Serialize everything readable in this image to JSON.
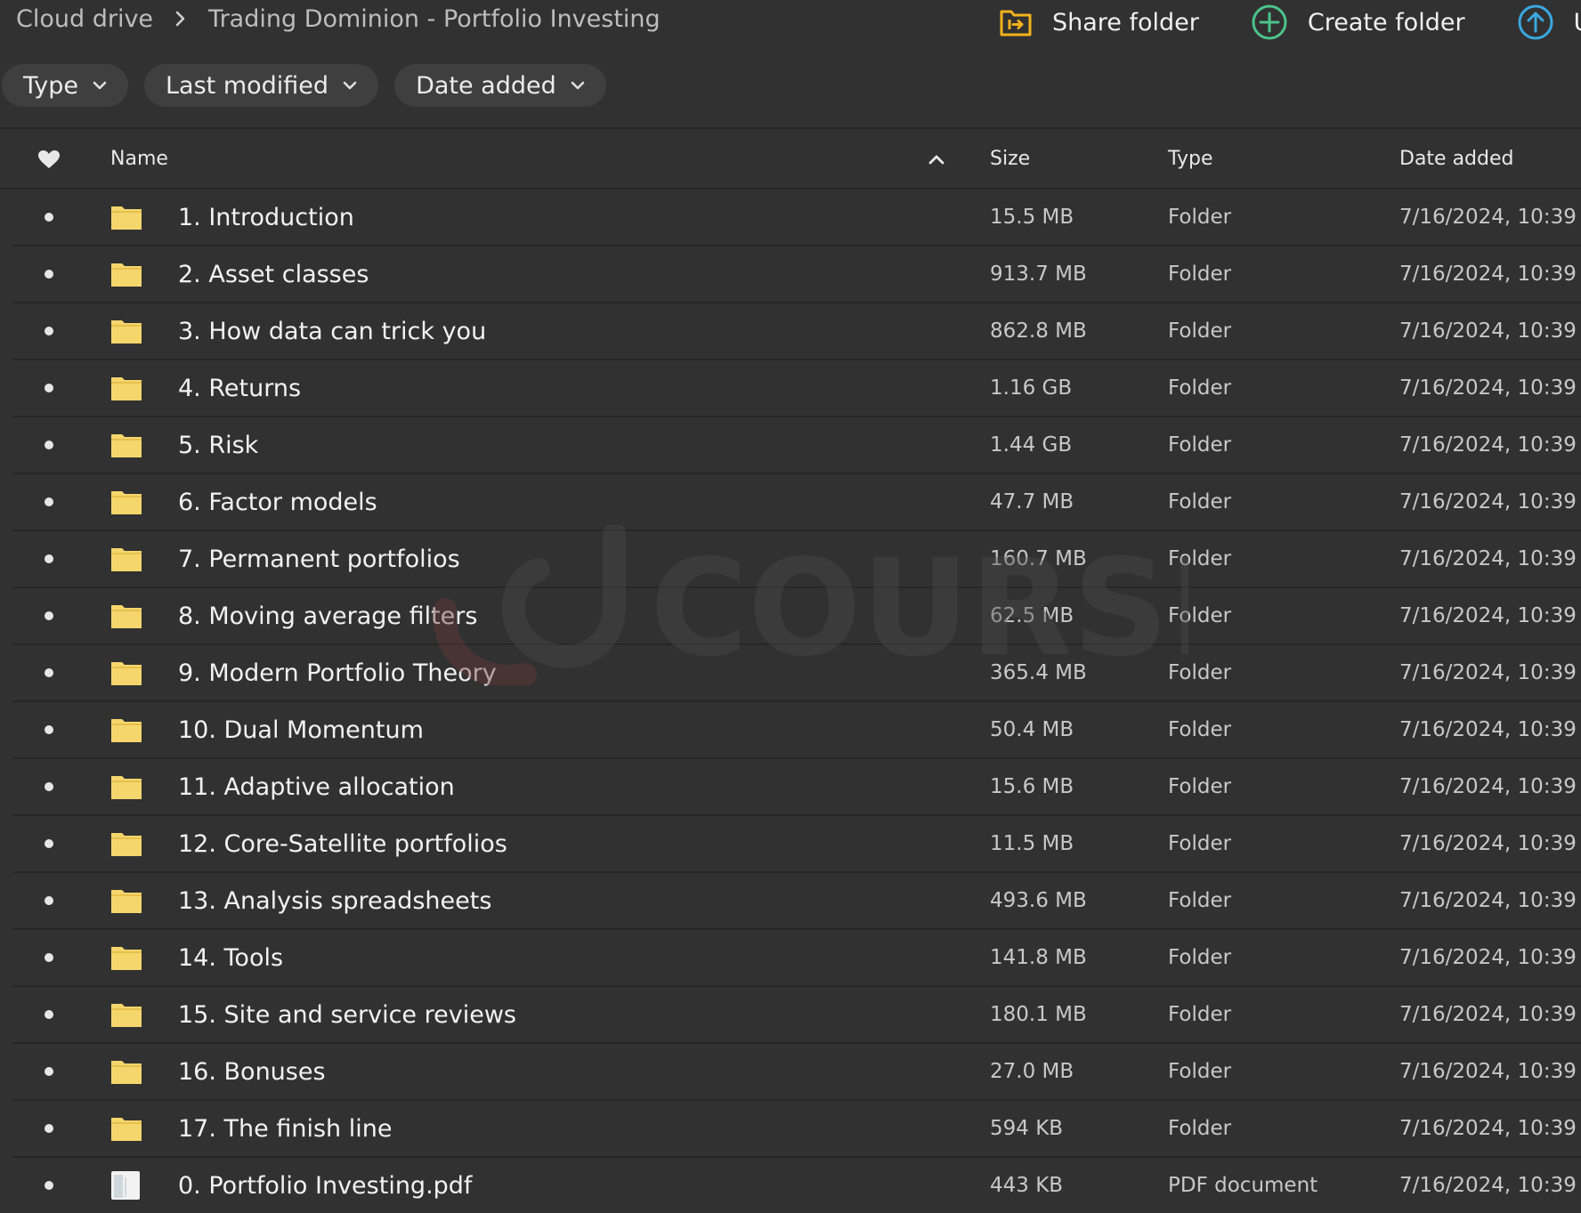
{
  "breadcrumb": {
    "root": "Cloud drive",
    "current": "Trading Dominion - Portfolio Investing"
  },
  "actions": {
    "share": "Share folder",
    "create": "Create folder",
    "upload": "Upl"
  },
  "filters": {
    "type": "Type",
    "last_modified": "Last modified",
    "date_added": "Date added"
  },
  "columns": {
    "name": "Name",
    "size": "Size",
    "type": "Type",
    "date": "Date added"
  },
  "watermark": {
    "text": "COURSE"
  },
  "colors": {
    "background": "#313131",
    "folder": "#f5d66c",
    "create_icon": "#4cc38a",
    "upload_icon": "#3aa9e0",
    "share_icon": "#f2b21b"
  },
  "files": [
    {
      "name": "1. Introduction",
      "size": "15.5 MB",
      "type": "Folder",
      "date": "7/16/2024, 10:39",
      "icon": "folder-icon"
    },
    {
      "name": "2. Asset classes",
      "size": "913.7 MB",
      "type": "Folder",
      "date": "7/16/2024, 10:39",
      "icon": "folder-icon"
    },
    {
      "name": "3. How data can trick you",
      "size": "862.8 MB",
      "type": "Folder",
      "date": "7/16/2024, 10:39",
      "icon": "folder-icon"
    },
    {
      "name": "4. Returns",
      "size": "1.16 GB",
      "type": "Folder",
      "date": "7/16/2024, 10:39",
      "icon": "folder-icon"
    },
    {
      "name": "5. Risk",
      "size": "1.44 GB",
      "type": "Folder",
      "date": "7/16/2024, 10:39",
      "icon": "folder-icon"
    },
    {
      "name": "6. Factor models",
      "size": "47.7 MB",
      "type": "Folder",
      "date": "7/16/2024, 10:39",
      "icon": "folder-icon"
    },
    {
      "name": "7. Permanent portfolios",
      "size": "160.7 MB",
      "type": "Folder",
      "date": "7/16/2024, 10:39",
      "icon": "folder-icon"
    },
    {
      "name": "8. Moving average filters",
      "size": "62.5 MB",
      "type": "Folder",
      "date": "7/16/2024, 10:39",
      "icon": "folder-icon"
    },
    {
      "name": "9. Modern Portfolio Theory",
      "size": "365.4 MB",
      "type": "Folder",
      "date": "7/16/2024, 10:39",
      "icon": "folder-icon"
    },
    {
      "name": "10. Dual Momentum",
      "size": "50.4 MB",
      "type": "Folder",
      "date": "7/16/2024, 10:39",
      "icon": "folder-icon"
    },
    {
      "name": "11. Adaptive allocation",
      "size": "15.6 MB",
      "type": "Folder",
      "date": "7/16/2024, 10:39",
      "icon": "folder-icon"
    },
    {
      "name": "12. Core-Satellite portfolios",
      "size": "11.5 MB",
      "type": "Folder",
      "date": "7/16/2024, 10:39",
      "icon": "folder-icon"
    },
    {
      "name": "13. Analysis spreadsheets",
      "size": "493.6 MB",
      "type": "Folder",
      "date": "7/16/2024, 10:39",
      "icon": "folder-icon"
    },
    {
      "name": "14. Tools",
      "size": "141.8 MB",
      "type": "Folder",
      "date": "7/16/2024, 10:39",
      "icon": "folder-icon"
    },
    {
      "name": "15. Site and service reviews",
      "size": "180.1 MB",
      "type": "Folder",
      "date": "7/16/2024, 10:39",
      "icon": "folder-icon"
    },
    {
      "name": "16. Bonuses",
      "size": "27.0 MB",
      "type": "Folder",
      "date": "7/16/2024, 10:39",
      "icon": "folder-icon"
    },
    {
      "name": "17. The finish line",
      "size": "594 KB",
      "type": "Folder",
      "date": "7/16/2024, 10:39",
      "icon": "folder-icon"
    },
    {
      "name": "0. Portfolio Investing.pdf",
      "size": "443 KB",
      "type": "PDF document",
      "date": "7/16/2024, 10:39",
      "icon": "pdf-file-icon"
    }
  ]
}
